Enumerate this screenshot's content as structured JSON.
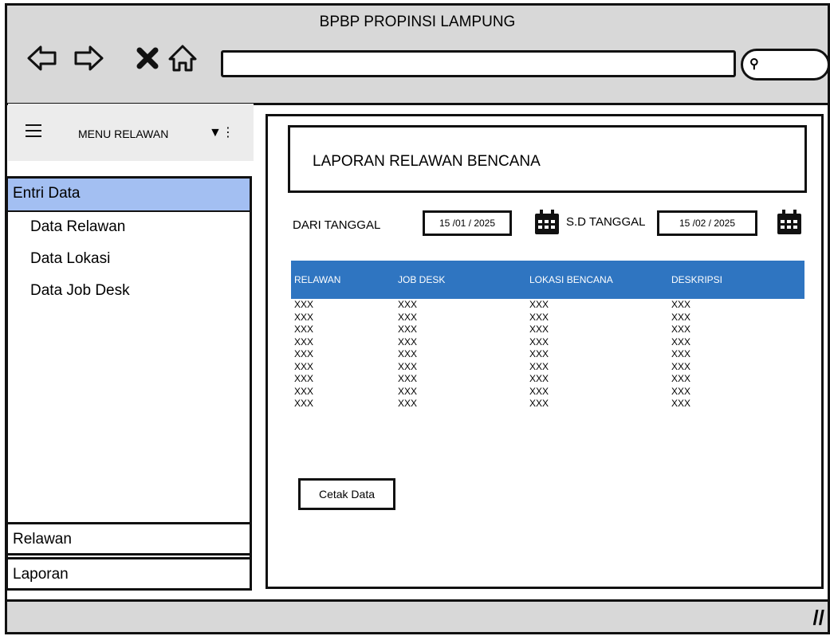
{
  "window": {
    "title": "BPBP PROPINSI LAMPUNG"
  },
  "icons": [
    "back-arrow-icon",
    "forward-arrow-icon",
    "close-icon",
    "home-icon",
    "search-icon",
    "hamburger-icon",
    "dropdown-icon",
    "calendar-icon",
    "resize-icon"
  ],
  "sidebar": {
    "header": "MENU RELAWAN",
    "active": "Entri Data",
    "items": [
      "Data Relawan",
      "Data Lokasi",
      "Data Job Desk"
    ],
    "bottom": [
      "Relawan",
      "Laporan"
    ]
  },
  "report": {
    "title": "LAPORAN RELAWAN BENCANA",
    "from_label": "DARI TANGGAL",
    "from_value": "15 /01  /  2025",
    "to_label": "S.D TANGGAL",
    "to_value": "15 /02  /  2025",
    "columns": [
      "RELAWAN",
      "JOB DESK",
      "LOKASI BENCANA",
      "DESKRIPSI"
    ],
    "rows": [
      [
        "XXX",
        "XXX",
        "XXX",
        "XXX"
      ],
      [
        "XXX",
        "XXX",
        "XXX",
        "XXX"
      ],
      [
        "XXX",
        "XXX",
        "XXX",
        "XXX"
      ],
      [
        "XXX",
        "XXX",
        "XXX",
        "XXX"
      ],
      [
        "XXX",
        "XXX",
        "XXX",
        "XXX"
      ],
      [
        "XXX",
        "XXX",
        "XXX",
        "XXX"
      ],
      [
        "XXX",
        "XXX",
        "XXX",
        "XXX"
      ],
      [
        "XXX",
        "XXX",
        "XXX",
        "XXX"
      ],
      [
        "XXX",
        "XXX",
        "XXX",
        "XXX"
      ]
    ],
    "print_label": "Cetak Data"
  },
  "colors": {
    "table_header": "#2f75c1",
    "active_menu": "#a3bff2",
    "chrome": "#d8d8d8"
  }
}
